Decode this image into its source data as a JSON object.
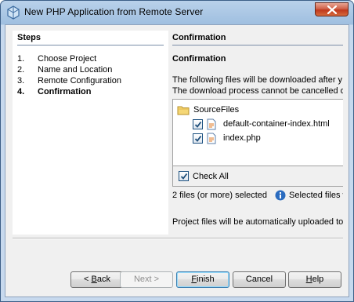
{
  "window": {
    "title": "New PHP Application from Remote Server"
  },
  "steps": {
    "header": "Steps",
    "items": [
      {
        "num": "1.",
        "label": "Choose Project",
        "active": false
      },
      {
        "num": "2.",
        "label": "Name and Location",
        "active": false
      },
      {
        "num": "3.",
        "label": "Remote Configuration",
        "active": false
      },
      {
        "num": "4.",
        "label": "Confirmation",
        "active": true
      }
    ]
  },
  "content": {
    "header": "Confirmation",
    "section_title": "Confirmation",
    "desc_line1": "The following files will be downloaded after y",
    "desc_line2": "The download process cannot be cancelled o",
    "tree": {
      "root": "SourceFiles",
      "files": [
        {
          "name": "default-container-index.html",
          "checked": true
        },
        {
          "name": "index.php",
          "checked": true
        }
      ]
    },
    "check_all_label": "Check All",
    "check_all_checked": true,
    "status_text": "2 files (or more) selected",
    "status_info": "Selected files w",
    "upload_note": "Project files will be automatically uploaded to"
  },
  "buttons": {
    "back_prefix": "< ",
    "back_u": "B",
    "back_rest": "ack",
    "next": "Next >",
    "finish_u": "F",
    "finish_rest": "inish",
    "cancel": "Cancel",
    "help_u": "H",
    "help_rest": "elp"
  },
  "colors": {
    "title_bar": "#9fbfe0",
    "close_button": "#c0391d",
    "client_bg": "#f0f0f0",
    "default_button_border": "#3c7fb1"
  }
}
